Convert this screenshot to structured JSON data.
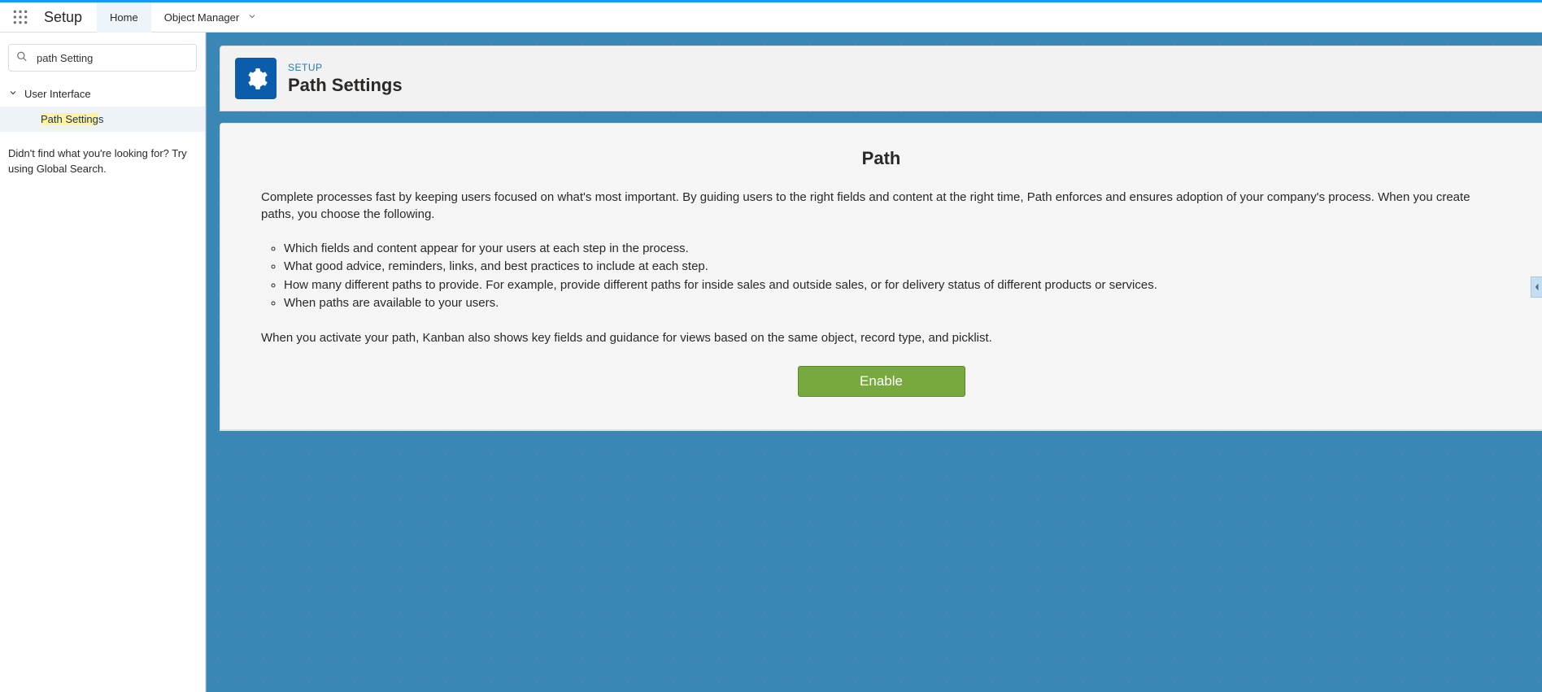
{
  "topnav": {
    "app_name": "Setup",
    "tabs": [
      {
        "label": "Home",
        "active": true
      },
      {
        "label": "Object Manager",
        "active": false
      }
    ]
  },
  "sidebar": {
    "search_value": "path Setting",
    "category": "User Interface",
    "item_highlight": "Path Setting",
    "item_tail": "s",
    "help_text": "Didn't find what you're looking for? Try using Global Search."
  },
  "header": {
    "eyebrow": "SETUP",
    "title": "Path Settings"
  },
  "content": {
    "heading": "Path",
    "intro": "Complete processes fast by keeping users focused on what's most important. By guiding users to the right fields and content at the right time, Path enforces and ensures adoption of your company's process. When you create paths, you choose the following.",
    "bullets": [
      "Which fields and content appear for your users at each step in the process.",
      "What good advice, reminders, links, and best practices to include at each step.",
      "How many different paths to provide. For example, provide different paths for inside sales and outside sales, or for delivery status of different products or services.",
      "When paths are available to your users."
    ],
    "footer": "When you activate your path, Kanban also shows key fields and guidance for views based on the same object, record type, and picklist.",
    "enable_label": "Enable"
  }
}
